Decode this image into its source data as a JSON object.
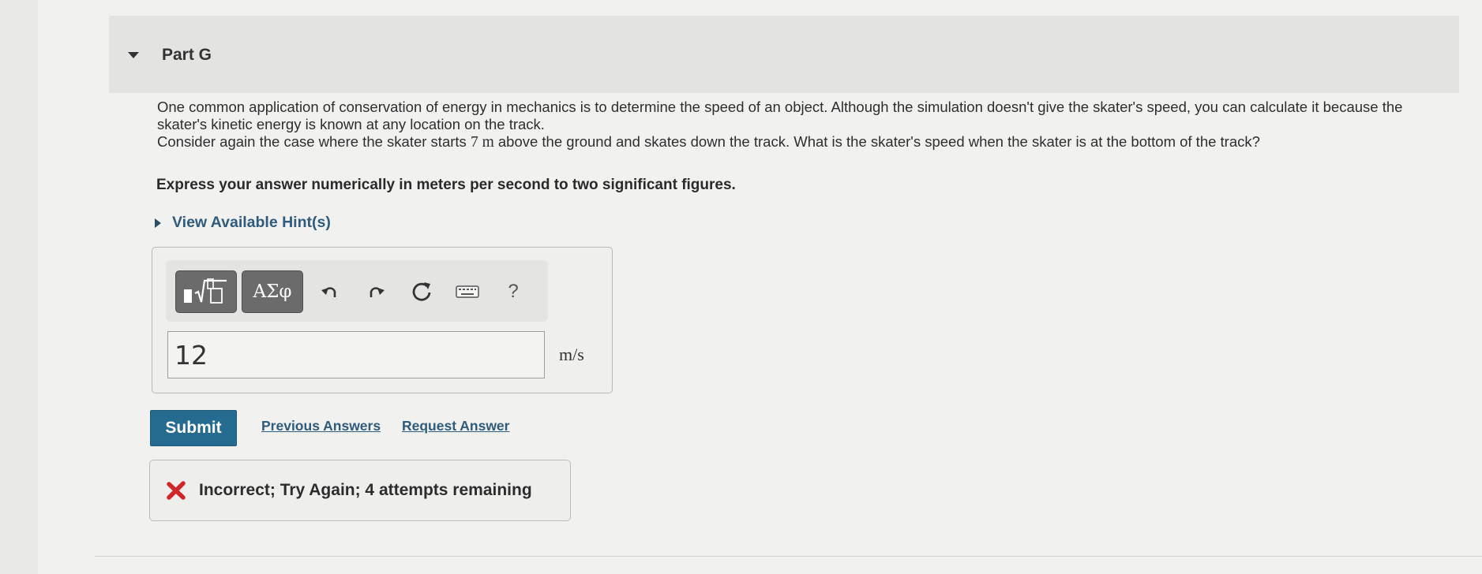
{
  "part": {
    "title": "Part G"
  },
  "question": {
    "line1": "One common application of conservation of energy in mechanics is to determine the speed of an object. Although the simulation doesn't give the skater's speed, you can calculate it because the skater's kinetic energy is known at any location on the track.",
    "line2_before": "Consider again the case where the skater starts ",
    "line2_math": "7 m",
    "line2_after": " above the ground and skates down the track. What is the skater's speed when the skater is at the bottom of the track?",
    "instruction": "Express your answer numerically in meters per second to two significant figures."
  },
  "hints": {
    "label": "View Available Hint(s)"
  },
  "toolbar": {
    "greek_label": "ΑΣφ",
    "help_label": "?"
  },
  "answer": {
    "value": "12",
    "units": "m/s"
  },
  "actions": {
    "submit_label": "Submit",
    "previous_answers": "Previous Answers",
    "request_answer": "Request Answer"
  },
  "feedback": {
    "message": "Incorrect; Try Again; 4 attempts remaining",
    "status_color": "#d0262a"
  }
}
